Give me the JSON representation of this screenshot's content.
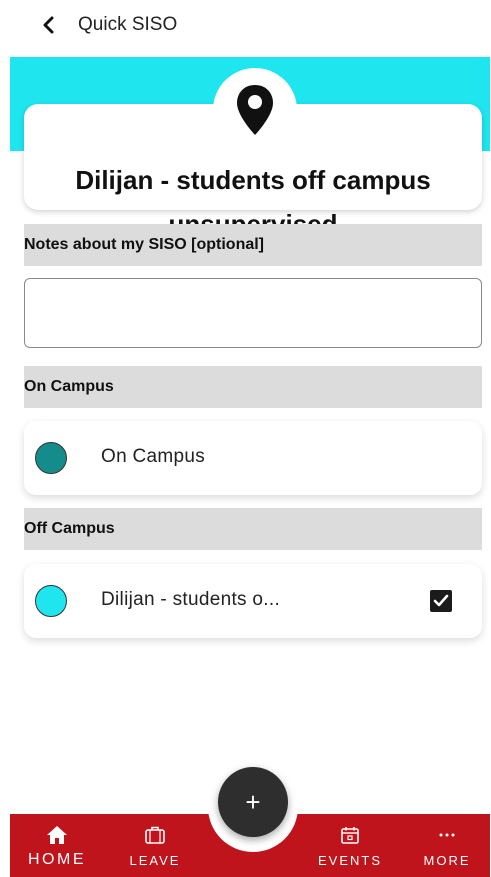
{
  "header": {
    "title": "Quick SISO",
    "back_icon": "chevron-left-icon"
  },
  "location": {
    "icon": "map-pin-icon",
    "title": "Dilijan - students off campus unsupervised",
    "accent_color": "#1fe5ef"
  },
  "notes": {
    "label": "Notes about my SISO [optional]",
    "value": "",
    "placeholder": ""
  },
  "sections": [
    {
      "header": "On Campus",
      "options": [
        {
          "label": "On Campus",
          "color": "#158c8c",
          "checked": false
        }
      ]
    },
    {
      "header": "Off Campus",
      "options": [
        {
          "label": "Dilijan - students o...",
          "color": "#1fe5ef",
          "checked": true
        }
      ]
    }
  ],
  "fab": {
    "label": "+",
    "icon": "plus-icon"
  },
  "bottom_nav": {
    "background": "#c0141c",
    "items": [
      {
        "label": "HOME",
        "icon": "home-icon",
        "active": true
      },
      {
        "label": "LEAVE",
        "icon": "suitcase-icon",
        "active": false
      },
      {
        "label": "EVENTS",
        "icon": "calendar-icon",
        "active": false
      },
      {
        "label": "MORE",
        "icon": "more-dots-icon",
        "active": false
      }
    ]
  }
}
